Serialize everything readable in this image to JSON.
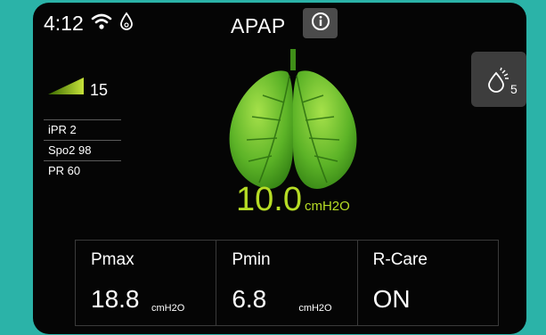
{
  "status_bar": {
    "time": "4:12"
  },
  "header": {
    "mode_title": "APAP"
  },
  "humidifier": {
    "level": "5"
  },
  "ramp": {
    "value": "15"
  },
  "side_list": {
    "items": [
      {
        "label": "iPR 2"
      },
      {
        "label": "Spo2 98"
      },
      {
        "label": "PR 60"
      }
    ]
  },
  "pressure": {
    "value": "10.0",
    "unit": "cmH2O",
    "color": "#b6dc25"
  },
  "params": [
    {
      "label": "Pmax",
      "value": "18.8",
      "unit": "cmH2O"
    },
    {
      "label": "Pmin",
      "value": "6.8",
      "unit": "cmH2O"
    },
    {
      "label": "R-Care",
      "value": "ON",
      "unit": ""
    }
  ],
  "icons": {
    "wifi": "wifi-icon",
    "water": "water-drop-icon",
    "info": "info-icon",
    "humidifier": "humidifier-icon",
    "ramp": "ramp-icon",
    "lungs": "lungs-icon"
  },
  "colors": {
    "background": "#2bb3a8",
    "screen": "#050505",
    "accent": "#b6dc25"
  }
}
